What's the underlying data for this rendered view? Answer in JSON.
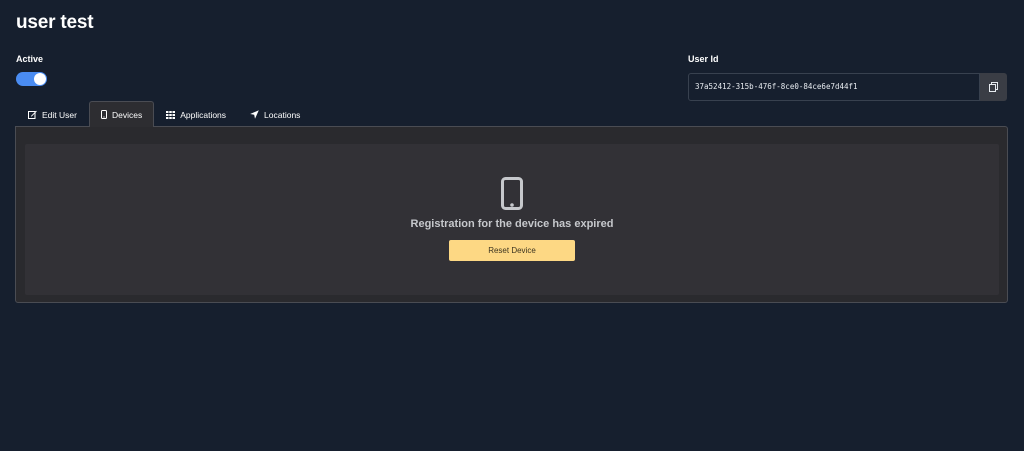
{
  "page": {
    "title": "user test"
  },
  "active": {
    "label": "Active",
    "on": true
  },
  "user_id": {
    "label": "User Id",
    "value": "37a52412-315b-476f-8ce0-84ce6e7d44f1",
    "copy_icon": "copy-icon"
  },
  "tabs": [
    {
      "label": "Edit User",
      "icon": "edit-icon",
      "active": false
    },
    {
      "label": "Devices",
      "icon": "mobile-icon",
      "active": true
    },
    {
      "label": "Applications",
      "icon": "grid-icon",
      "active": false
    },
    {
      "label": "Locations",
      "icon": "location-arrow-icon",
      "active": false
    }
  ],
  "devices": {
    "message": "Registration for the device has expired",
    "reset_label": "Reset Device",
    "icon": "mobile-phone-icon"
  },
  "colors": {
    "background": "#161f2e",
    "toggle": "#4a8cf2",
    "reset_button": "#fdd884",
    "panel": "#2a2a2e"
  }
}
